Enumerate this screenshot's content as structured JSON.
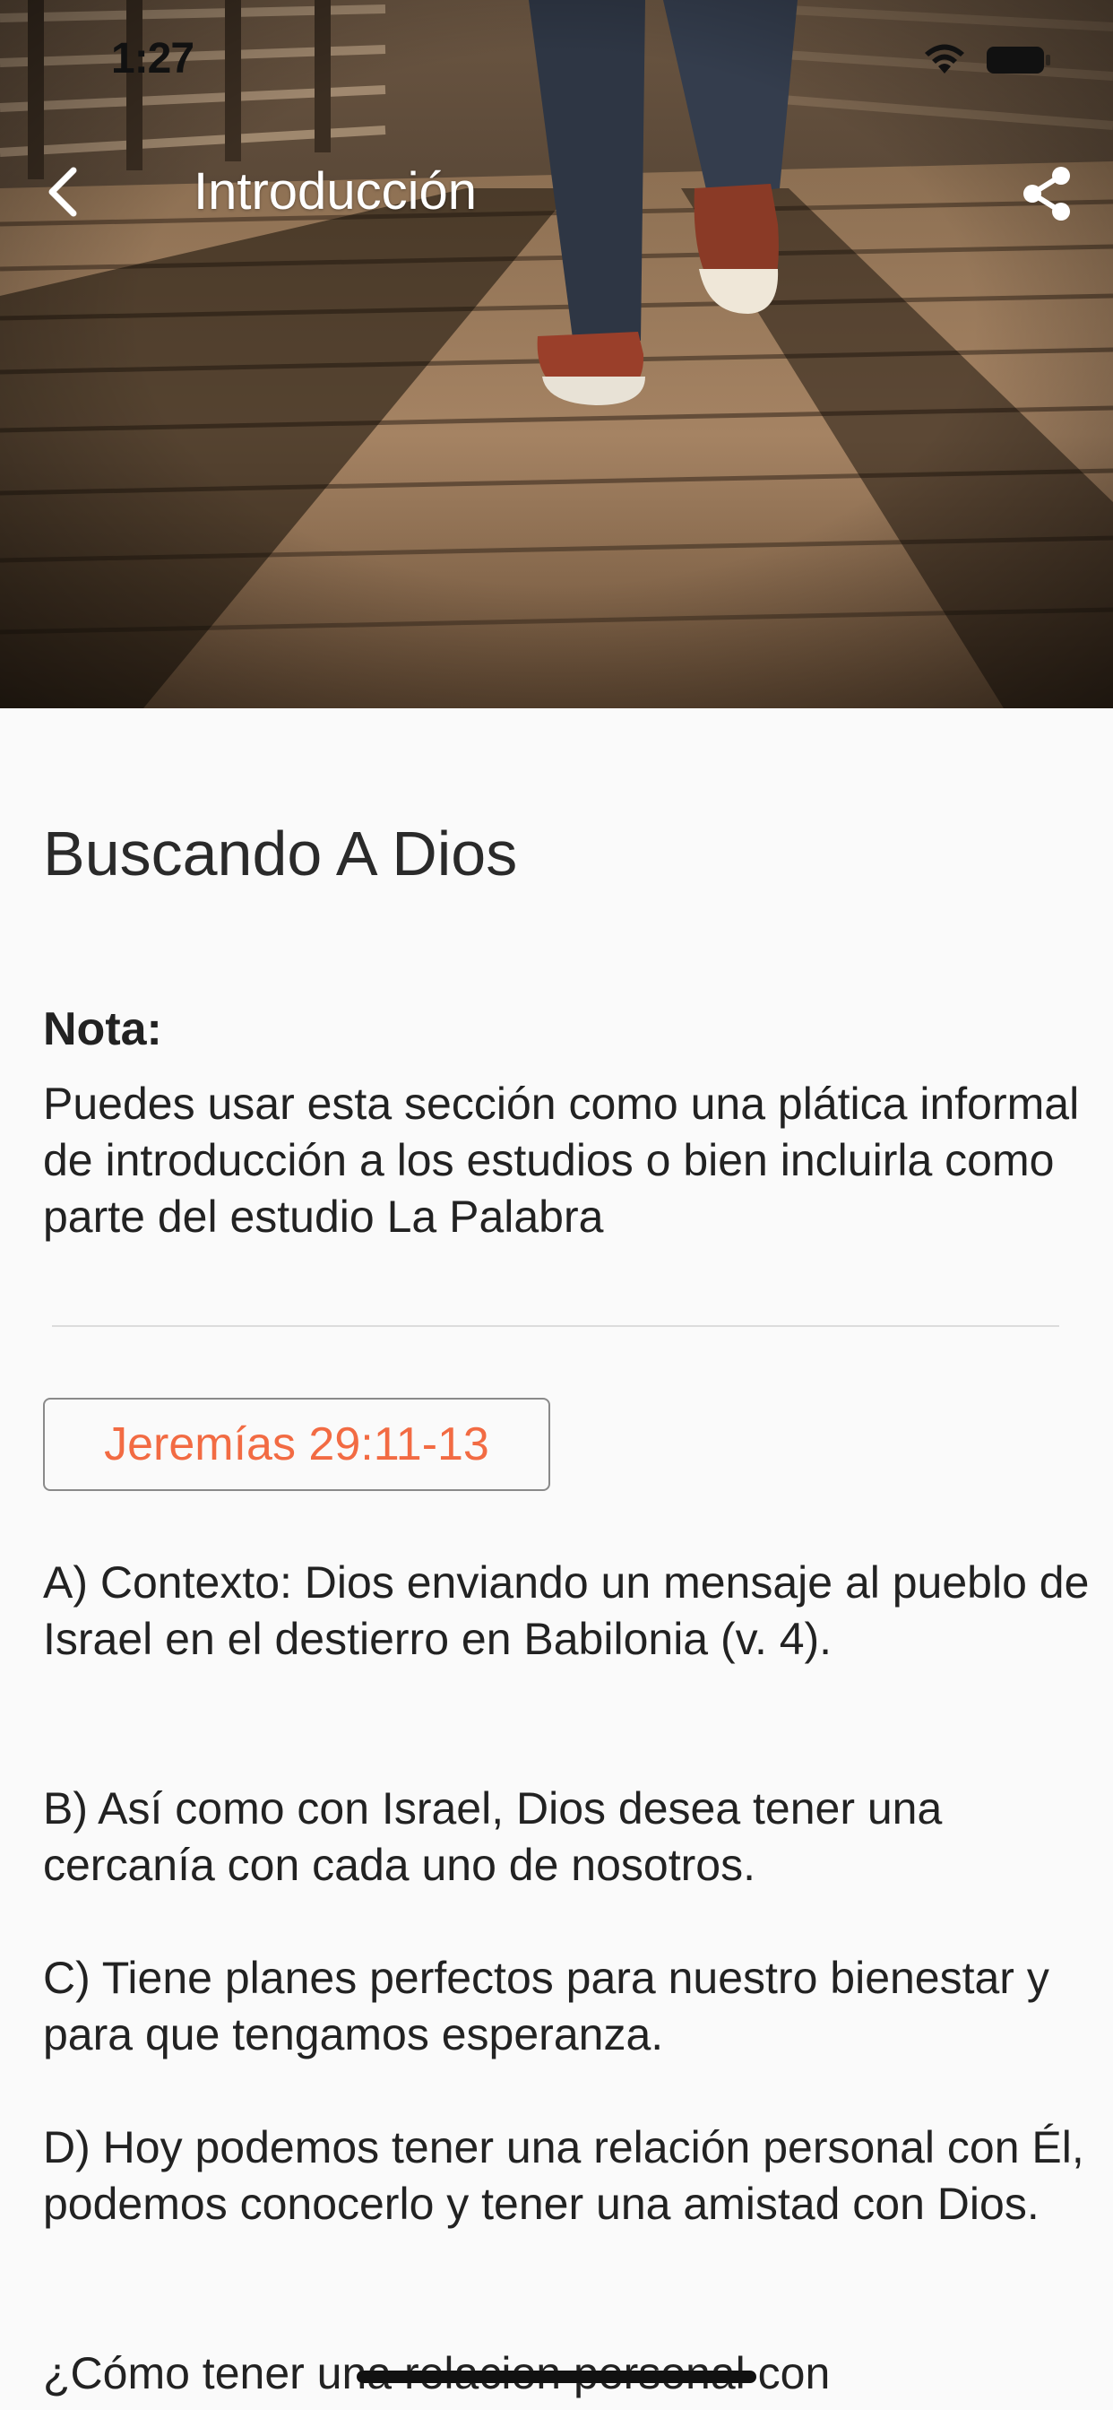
{
  "status_bar": {
    "time": "1:27",
    "wifi_icon": "wifi-icon",
    "battery_icon": "battery-icon"
  },
  "nav": {
    "back_icon": "chevron-left-icon",
    "title": "Introducción",
    "share_icon": "share-icon",
    "title_color": "#ffffff"
  },
  "hero": {
    "image": "person-walking-on-wooden-boardwalk-photo"
  },
  "content": {
    "title": "Buscando A Dios",
    "note_label": "Nota:",
    "note_text": "Puedes usar esta sección como una plática informal de introducción a los estudios o bien incluirla como parte del estudio La Palabra",
    "verse_button_label": "Jeremías 29:11-13",
    "verse_button_color": "#f26b43",
    "paragraphs": [
      "A) Contexto: Dios enviando un mensaje al pueblo de Israel en el destierro en Babilonia (v. 4).",
      "B) Así como con Israel, Dios desea tener una cercanía con cada uno de nosotros.",
      "C) Tiene planes perfectos para nuestro bienestar y para que tengamos esperanza.",
      "D) Hoy podemos tener una relación personal con Él, podemos conocerlo y tener una amistad con Dios.",
      "¿Cómo tener una relacion personal con"
    ]
  }
}
